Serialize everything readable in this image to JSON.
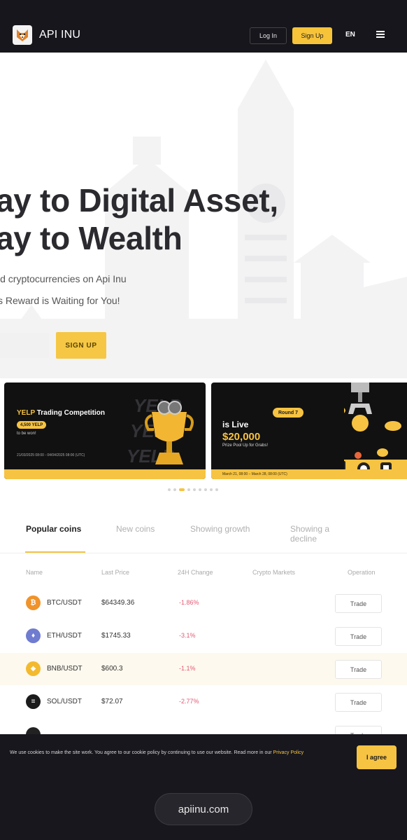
{
  "header": {
    "app_title": "API INU",
    "login_label": "Log In",
    "signup_label": "Sign Up",
    "language": "EN",
    "logo_icon": "shiba-logo-icon",
    "menu_icon": "hamburger-menu-icon"
  },
  "hero": {
    "headline_line1": "ay to Digital Asset,",
    "headline_line2": "ay to Wealth",
    "subtitle_line1": "ld cryptocurrencies on Api Inu",
    "subtitle_line2": "s Reward is Waiting for You!",
    "signup_button": "SIGN UP"
  },
  "banners": [
    {
      "brand": "YELP",
      "title": "Trading Competition",
      "pill": "4,500 YELP",
      "subtitle": "to be won!",
      "dates": "21/03/2025 08:00 - 04/04/2025 08:00 (UTC)",
      "watermark": "YELP"
    },
    {
      "round": "Round 7",
      "status": "is Live",
      "amount": "$20,000",
      "pool_text": "Prize Pool Up for Grabs!",
      "dates": "March 21, 08:00 – March 28, 08:00 (UTC)"
    }
  ],
  "carousel": {
    "dot_count": 9,
    "active_index": 2
  },
  "tabs": [
    {
      "label": "Popular coins",
      "active": true
    },
    {
      "label": "New coins",
      "active": false
    },
    {
      "label": "Showing growth",
      "active": false
    },
    {
      "label": "Showing a decline",
      "active": false
    }
  ],
  "table": {
    "columns": [
      "Name",
      "Last Price",
      "24H Change",
      "Crypto Markets",
      "Operation"
    ],
    "trade_label": "Trade",
    "rows": [
      {
        "pair": "BTC/USDT",
        "price": "$64349.36",
        "change": "-1.86%",
        "icon": "bitcoin-icon",
        "color": "#f0932b"
      },
      {
        "pair": "ETH/USDT",
        "price": "$1745.33",
        "change": "-3.1%",
        "icon": "ethereum-icon",
        "color": "#6f7ccf"
      },
      {
        "pair": "BNB/USDT",
        "price": "$600.3",
        "change": "-1.1%",
        "icon": "bnb-icon",
        "color": "#f3ba2f",
        "highlighted": true
      },
      {
        "pair": "SOL/USDT",
        "price": "$72.07",
        "change": "-2.77%",
        "icon": "solana-icon",
        "color": "#1b1b1b"
      }
    ]
  },
  "cookie": {
    "text": "We use cookies to make the site work. You agree to our cookie policy by continuing to use our website. Read more in our",
    "link": "Privacy Policy",
    "agree_label": "I agree"
  },
  "browser": {
    "url": "apiinu.com"
  }
}
